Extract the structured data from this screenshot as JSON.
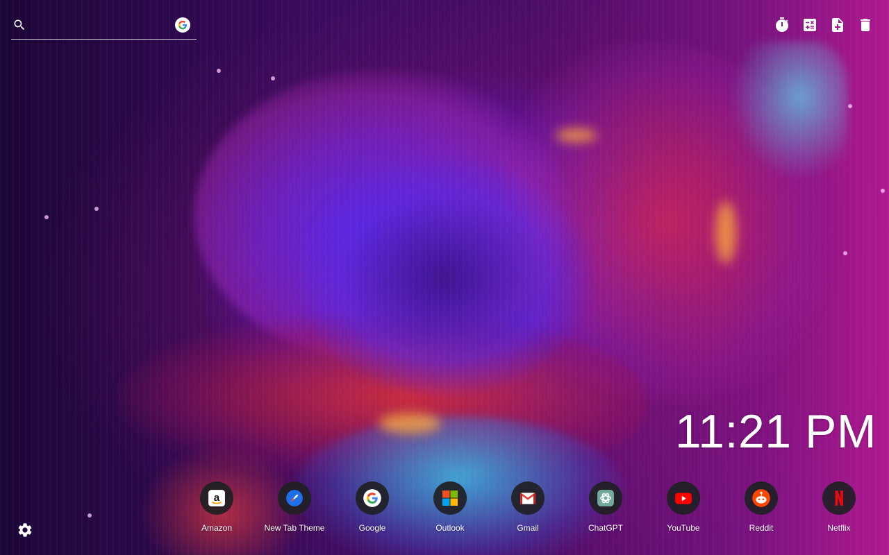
{
  "search": {
    "value": "",
    "placeholder": "",
    "icon": "search-icon",
    "engine_icon": "google-icon"
  },
  "toolbar": {
    "tools": [
      {
        "icon": "timer-icon"
      },
      {
        "icon": "calculator-icon"
      },
      {
        "icon": "new-note-icon"
      },
      {
        "icon": "trash-icon"
      }
    ]
  },
  "clock": {
    "time": "11:21 PM"
  },
  "shortcuts": [
    {
      "label": "Amazon",
      "icon": "amazon-icon"
    },
    {
      "label": "New Tab Theme",
      "icon": "new-tab-theme-icon"
    },
    {
      "label": "Google",
      "icon": "google-icon"
    },
    {
      "label": "Outlook",
      "icon": "microsoft-icon"
    },
    {
      "label": "Gmail",
      "icon": "gmail-icon"
    },
    {
      "label": "ChatGPT",
      "icon": "chatgpt-icon"
    },
    {
      "label": "YouTube",
      "icon": "youtube-icon"
    },
    {
      "label": "Reddit",
      "icon": "reddit-icon"
    },
    {
      "label": "Netflix",
      "icon": "netflix-icon"
    }
  ],
  "settings": {
    "icon": "gear-icon"
  },
  "colors": {
    "text": "#ffffff",
    "shortcut_bg": "#202024",
    "google_blue": "#4285F4",
    "google_red": "#EA4335",
    "google_yellow": "#FBBC05",
    "google_green": "#34A853",
    "youtube_red": "#FF0000",
    "reddit_orange": "#FF4500",
    "netflix_red": "#E50914"
  }
}
